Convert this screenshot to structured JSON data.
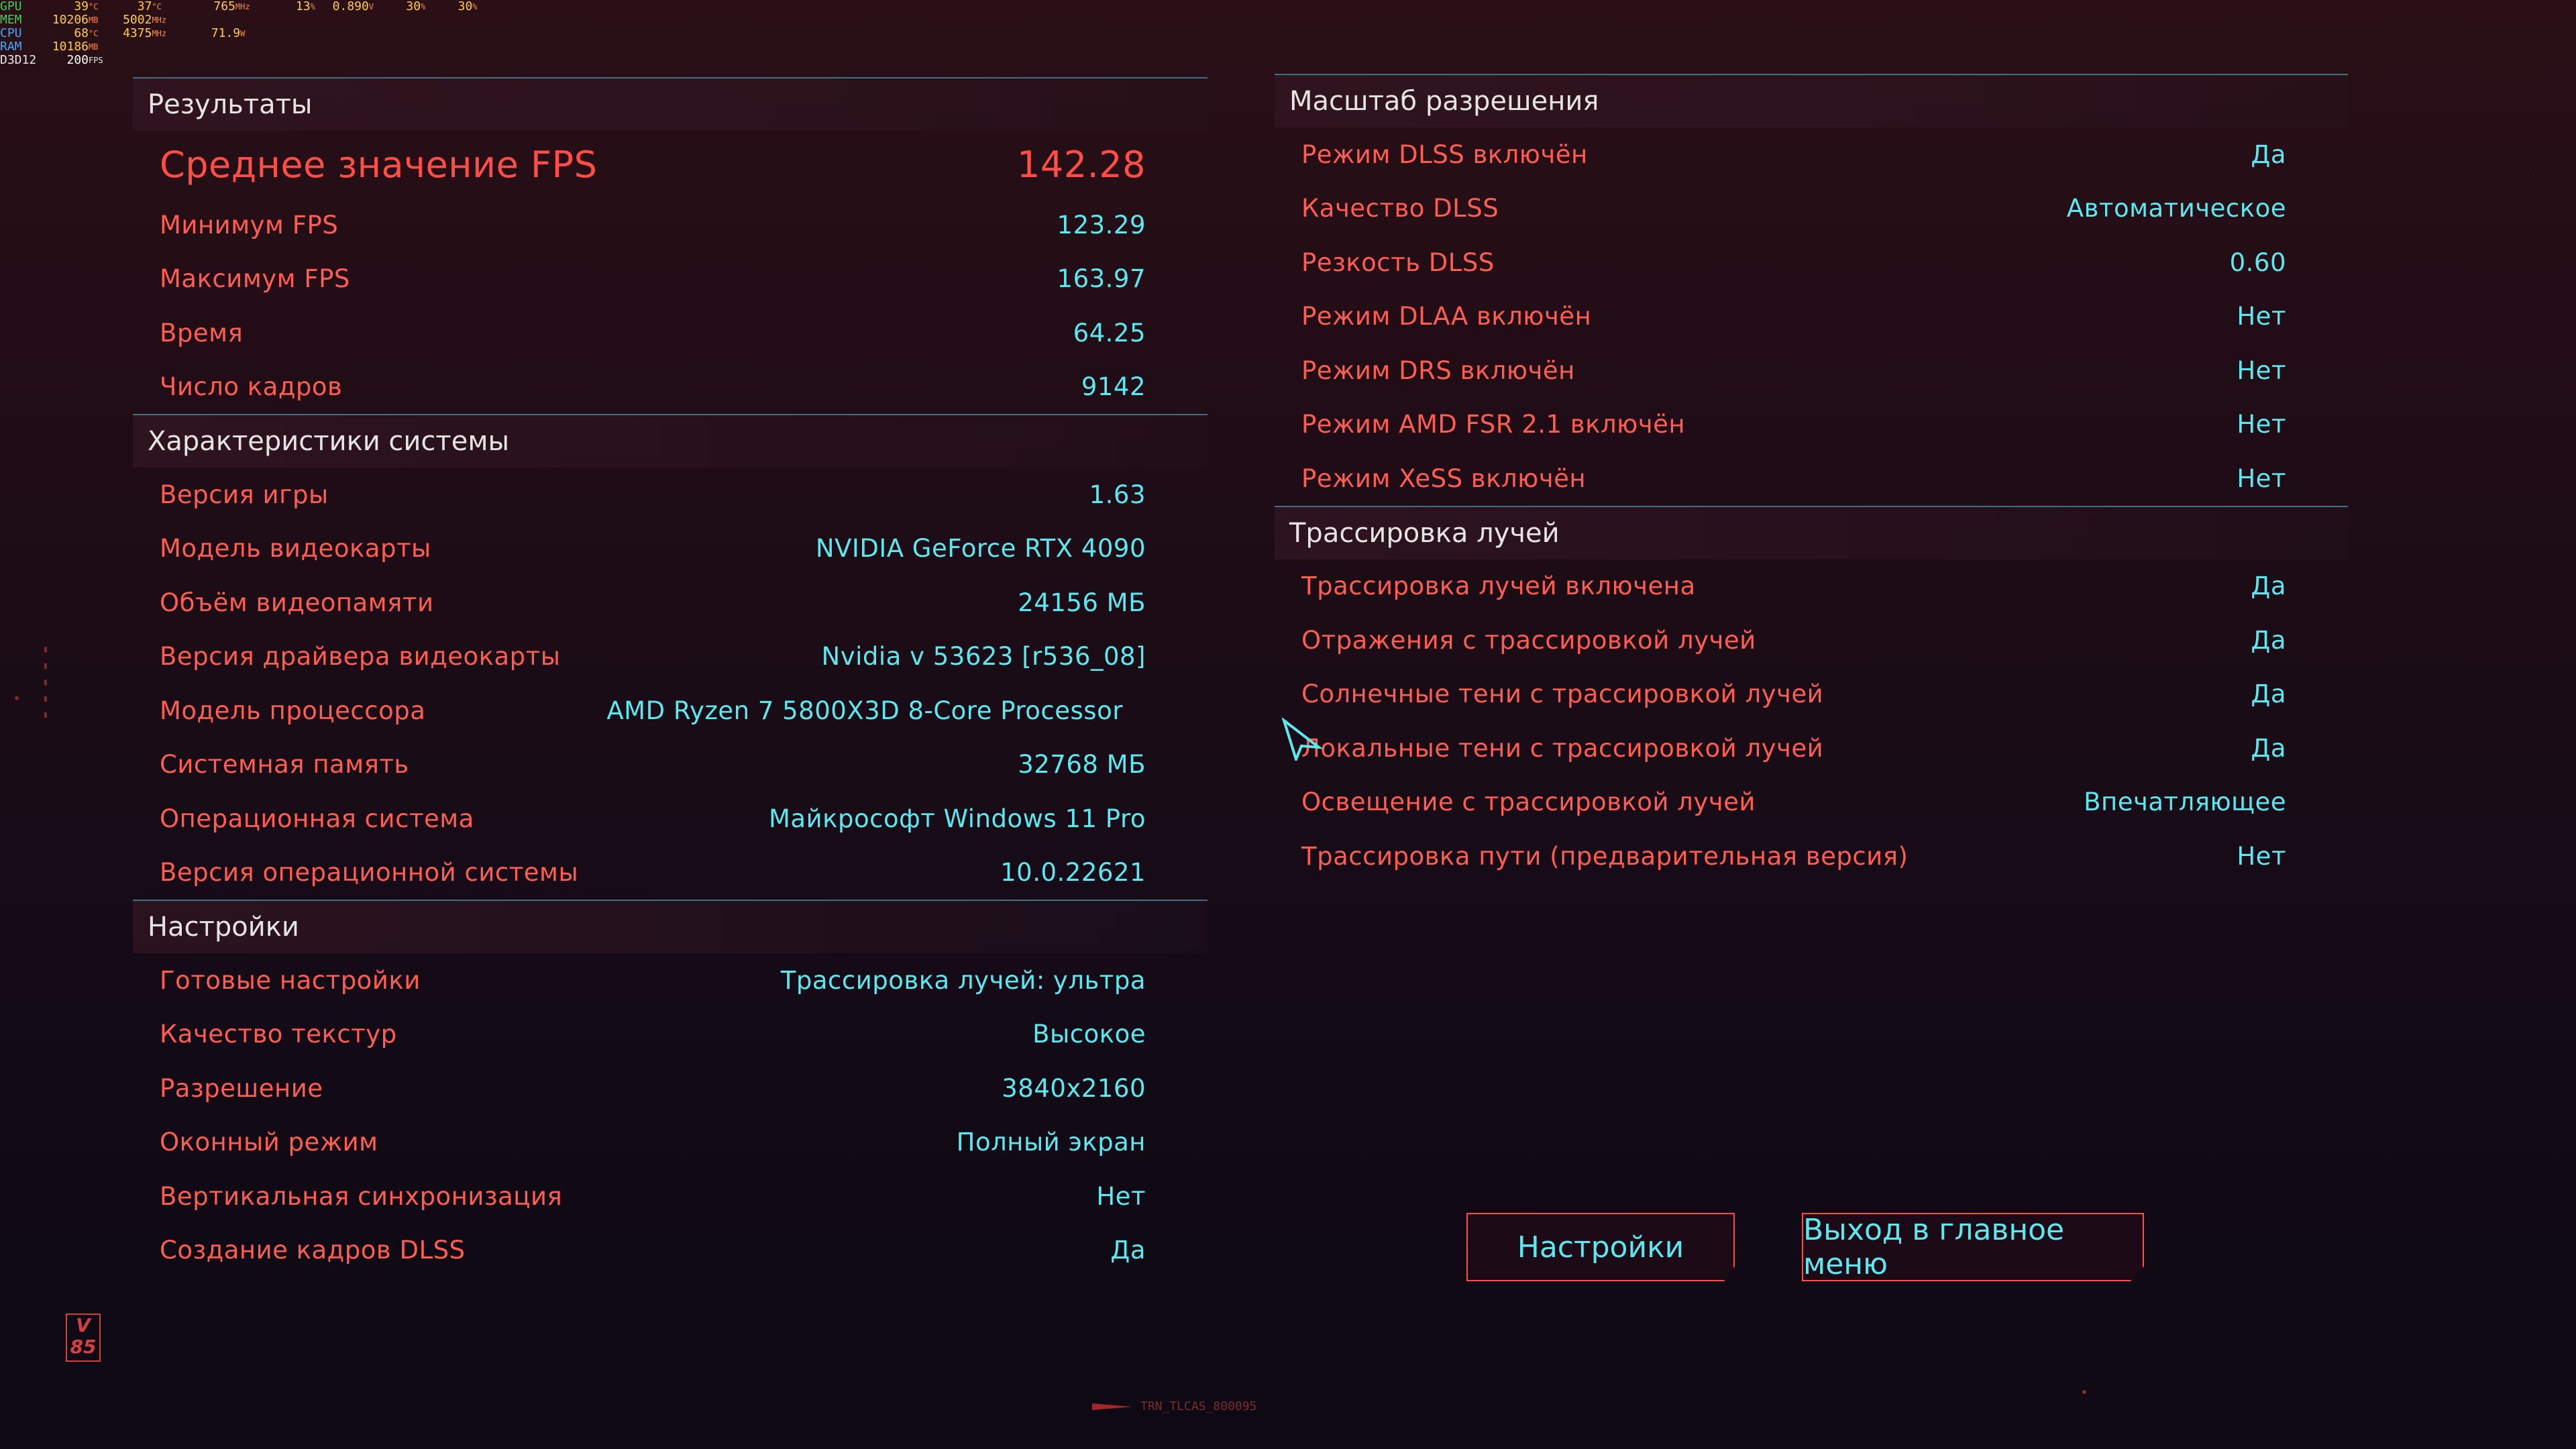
{
  "overlay": {
    "rows": [
      {
        "label": "GPU",
        "color": "#39d353",
        "values": [
          "39",
          "37",
          "765",
          "13",
          "0.890",
          "30",
          "30"
        ],
        "units": [
          "°C",
          "°C",
          "MHz",
          "%",
          "V",
          "%",
          "%"
        ]
      },
      {
        "label": "MEM",
        "color": "#39d353",
        "values": [
          "10206",
          "5002",
          "",
          "",
          "",
          "",
          ""
        ],
        "units": [
          "MB",
          "MHz",
          "",
          "",
          "",
          "",
          ""
        ]
      },
      {
        "label": "CPU",
        "color": "#3fa8ff",
        "values": [
          "68",
          "4375",
          "71.9",
          "",
          "",
          "",
          ""
        ],
        "units": [
          "°C",
          "MHz",
          "W",
          "",
          "",
          "",
          ""
        ]
      },
      {
        "label": "RAM",
        "color": "#3fa8ff",
        "values": [
          "10186",
          "",
          "",
          "",
          "",
          "",
          ""
        ],
        "units": [
          "MB",
          "",
          "",
          "",
          "",
          "",
          ""
        ]
      },
      {
        "label": "D3D12",
        "color": "#e8e8e8",
        "values": [
          "200",
          "",
          "",
          "",
          "",
          "",
          ""
        ],
        "units": [
          "FPS",
          "",
          "",
          "",
          "",
          "",
          ""
        ]
      }
    ]
  },
  "left": {
    "results": {
      "title": "Результаты",
      "avg_fps_label": "Среднее значение FPS",
      "avg_fps_value": "142.28",
      "rows": [
        {
          "label": "Минимум FPS",
          "value": "123.29"
        },
        {
          "label": "Максимум FPS",
          "value": "163.97"
        },
        {
          "label": "Время",
          "value": "64.25"
        },
        {
          "label": "Число кадров",
          "value": "9142"
        }
      ]
    },
    "system": {
      "title": "Характеристики системы",
      "rows": [
        {
          "label": "Версия игры",
          "value": "1.63"
        },
        {
          "label": "Модель видеокарты",
          "value": "NVIDIA GeForce RTX 4090"
        },
        {
          "label": "Объём видеопамяти",
          "value": "24156 МБ"
        },
        {
          "label": "Версия драйвера видеокарты",
          "value": "Nvidia v 53623 [r536_08]"
        },
        {
          "label": "Модель процессора",
          "value": "AMD Ryzen 7 5800X3D 8-Core Processor"
        },
        {
          "label": "Системная память",
          "value": "32768 МБ"
        },
        {
          "label": "Операционная система",
          "value": "Майкрософт Windows 11 Pro"
        },
        {
          "label": "Версия операционной системы",
          "value": "10.0.22621"
        }
      ]
    },
    "settings": {
      "title": "Настройки",
      "rows": [
        {
          "label": "Готовые настройки",
          "value": "Трассировка лучей: ультра"
        },
        {
          "label": "Качество текстур",
          "value": "Высокое"
        },
        {
          "label": "Разрешение",
          "value": "3840x2160"
        },
        {
          "label": "Оконный режим",
          "value": "Полный экран"
        },
        {
          "label": "Вертикальная синхронизация",
          "value": "Нет"
        },
        {
          "label": "Создание кадров DLSS",
          "value": "Да"
        }
      ]
    }
  },
  "right": {
    "scaling": {
      "title": "Масштаб разрешения",
      "rows": [
        {
          "label": "Режим DLSS включён",
          "value": "Да"
        },
        {
          "label": "Качество DLSS",
          "value": "Автоматическое"
        },
        {
          "label": "Резкость DLSS",
          "value": "0.60"
        },
        {
          "label": "Режим DLAA включён",
          "value": "Нет"
        },
        {
          "label": "Режим DRS включён",
          "value": "Нет"
        },
        {
          "label": "Режим AMD FSR 2.1 включён",
          "value": "Нет"
        },
        {
          "label": "Режим XeSS включён",
          "value": "Нет"
        }
      ]
    },
    "raytracing": {
      "title": "Трассировка лучей",
      "rows": [
        {
          "label": "Трассировка лучей включена",
          "value": "Да"
        },
        {
          "label": "Отражения с трассировкой лучей",
          "value": "Да"
        },
        {
          "label": "Солнечные тени с трассировкой лучей",
          "value": "Да"
        },
        {
          "label": "Локальные тени с трассировкой лучей",
          "value": "Да"
        },
        {
          "label": "Освещение с трассировкой лучей",
          "value": "Впечатляющее"
        },
        {
          "label": "Трассировка пути (предварительная версия)",
          "value": "Нет"
        }
      ]
    }
  },
  "buttons": {
    "settings": "Настройки",
    "exit": "Выход в главное меню"
  },
  "footer": {
    "logo": "V 85",
    "build": "TRN_TLCAS_800095"
  }
}
